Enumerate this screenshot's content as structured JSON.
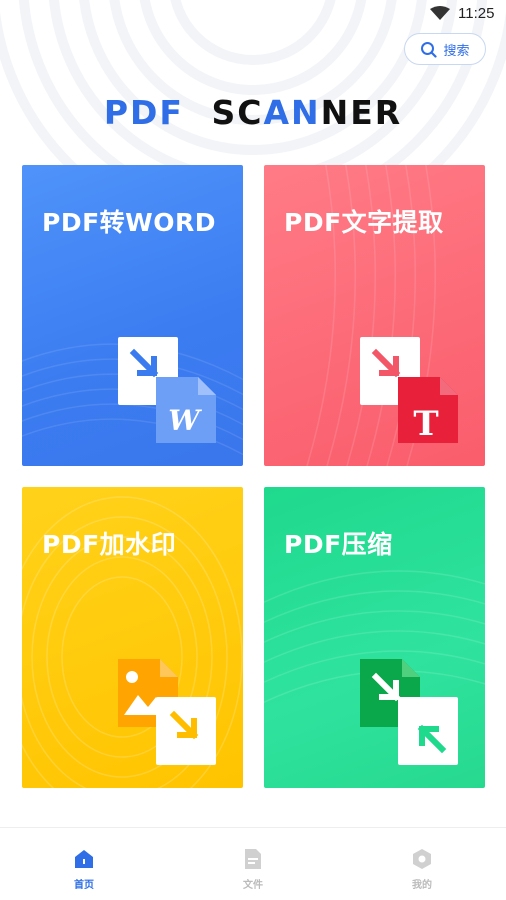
{
  "status_bar": {
    "time": "11:25"
  },
  "header": {
    "search_label": "搜索"
  },
  "logo": {
    "part1": "PDF",
    "part2": "SC",
    "part3": "AN",
    "part4": "NER"
  },
  "cards": [
    {
      "id": "pdf-to-word",
      "title": "PDF转WORD",
      "illustration_letter": "W"
    },
    {
      "id": "pdf-text-extract",
      "title": "PDF文字提取",
      "illustration_letter": "T"
    },
    {
      "id": "pdf-watermark",
      "title": "PDF加水印"
    },
    {
      "id": "pdf-compress",
      "title": "PDF压缩"
    }
  ],
  "tabs": [
    {
      "label": "首页",
      "icon": "home-icon",
      "active": true
    },
    {
      "label": "文件",
      "icon": "file-icon",
      "active": false
    },
    {
      "label": "我的",
      "icon": "profile-icon",
      "active": false
    }
  ],
  "colors": {
    "accent": "#2f6ee6",
    "card_word": "#3b7cf1",
    "card_text": "#fa5d6c",
    "card_mark": "#ffc400",
    "card_zip": "#27d98f",
    "tab_inactive": "#bbbbbb"
  }
}
